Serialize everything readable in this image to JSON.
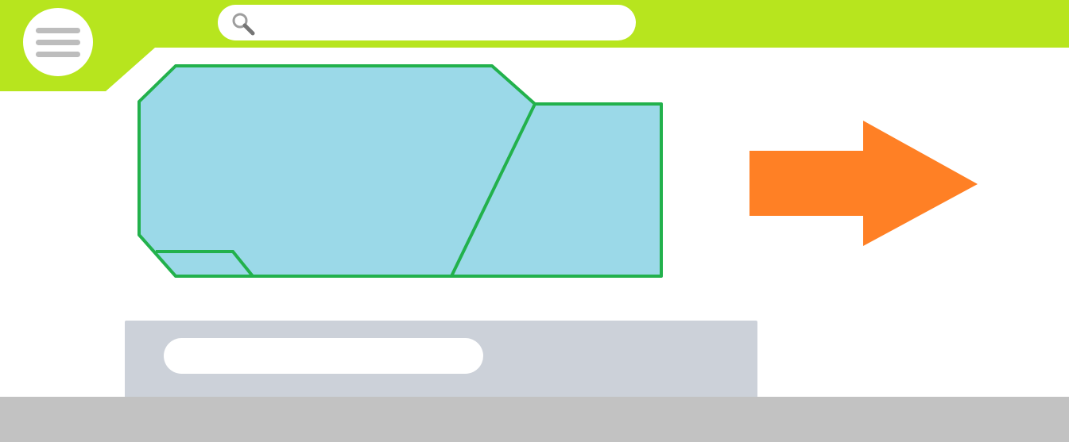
{
  "colors": {
    "header_bg": "#b7e51e",
    "surface": "#ffffff",
    "shape_fill": "#9bd9e8",
    "shape_stroke": "#22b14c",
    "arrow": "#ff8025",
    "card_bg": "#ccd1d9",
    "footer_bg": "#c2c2c2",
    "icon_gray": "#bdbdbd"
  },
  "header": {
    "menu_icon": "hamburger-menu-icon",
    "search": {
      "icon": "search-icon",
      "placeholder": "",
      "value": ""
    }
  },
  "canvas": {
    "shape": "polygon-divided-into-three-regions",
    "arrow_icon": "arrow-right-icon"
  },
  "card": {
    "pill_text": ""
  }
}
